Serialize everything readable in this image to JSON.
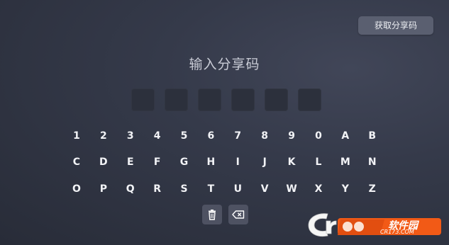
{
  "header": {
    "get_code_label": "获取分享码"
  },
  "title": "输入分享码",
  "code_slots": [
    "",
    "",
    "",
    "",
    "",
    ""
  ],
  "keyboard": {
    "keys": [
      "1",
      "2",
      "3",
      "4",
      "5",
      "6",
      "7",
      "8",
      "9",
      "0",
      "A",
      "B",
      "C",
      "D",
      "E",
      "F",
      "G",
      "H",
      "I",
      "J",
      "K",
      "L",
      "M",
      "N",
      "O",
      "P",
      "Q",
      "R",
      "S",
      "T",
      "U",
      "V",
      "W",
      "X",
      "Y",
      "Z"
    ]
  },
  "actions": {
    "delete_icon": "trash-icon",
    "backspace_icon": "backspace-icon"
  },
  "watermark": {
    "title": "软件园",
    "domain": "CR173.COM",
    "accent_color": "#f25a16"
  },
  "colors": {
    "background": "#353a4a",
    "button": "#5a5f70",
    "code_box": "#2c303c",
    "key_text": "#f2f3f6",
    "title_text": "#c9ccd6"
  }
}
